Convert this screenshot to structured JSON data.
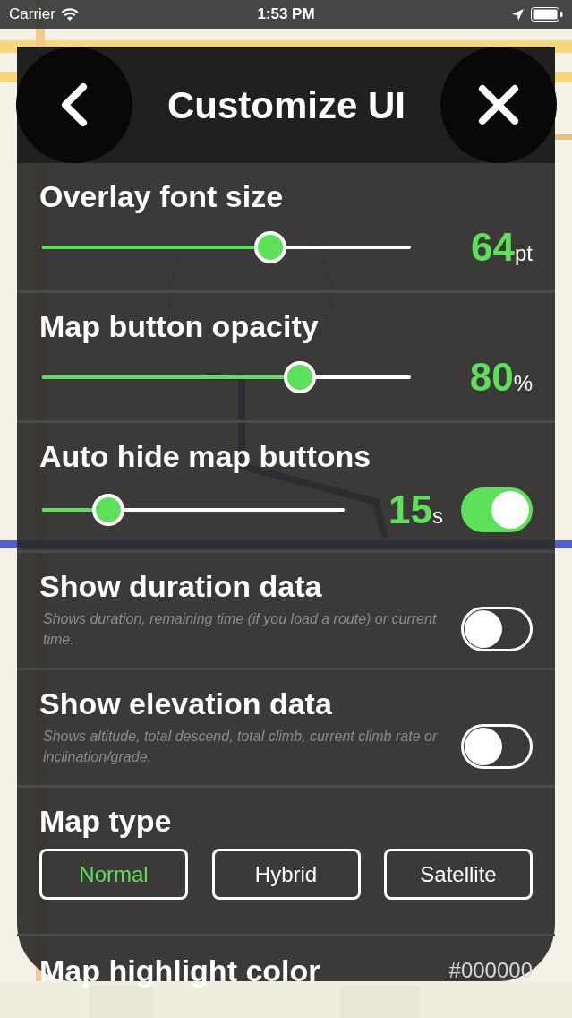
{
  "status_bar": {
    "carrier": "Carrier",
    "time": "1:53 PM"
  },
  "panel": {
    "title": "Customize UI",
    "settings": [
      {
        "kind": "slider",
        "label": "Overlay font size",
        "level": 0.62,
        "value": "64",
        "unit": "pt"
      },
      {
        "kind": "slider",
        "label": "Map button opacity",
        "level": 0.7,
        "value": "80",
        "unit": "%"
      },
      {
        "kind": "slider_toggle",
        "label": "Auto hide map buttons",
        "level": 0.22,
        "value": "15",
        "unit": "s",
        "on": true
      },
      {
        "kind": "toggle",
        "label": "Show duration data",
        "description": "Shows duration, remaining time (if you load a route) or current time.",
        "on": false
      },
      {
        "kind": "toggle",
        "label": "Show elevation data",
        "description": "Shows altitude, total descend, total climb, current climb rate or inclination/grade.",
        "on": false
      },
      {
        "kind": "segmented",
        "label": "Map type",
        "options": [
          {
            "label": "Normal",
            "selected": true
          },
          {
            "label": "Hybrid",
            "selected": false
          },
          {
            "label": "Satellite",
            "selected": false
          }
        ]
      },
      {
        "kind": "color",
        "label": "Map highlight color",
        "value": "#000000"
      }
    ]
  }
}
